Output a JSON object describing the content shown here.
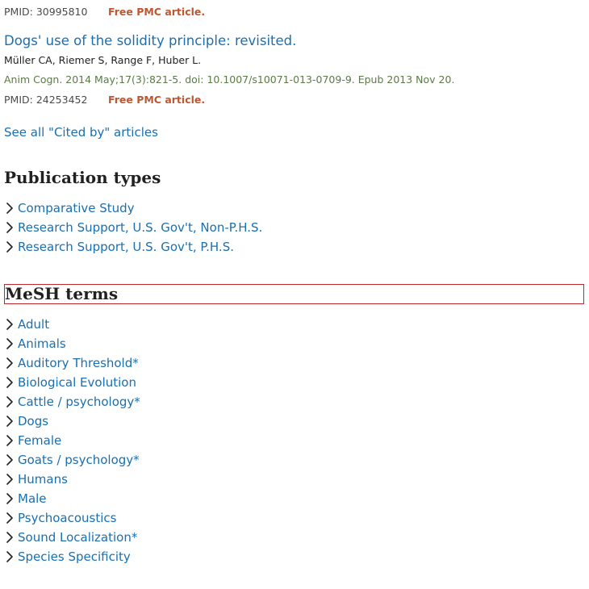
{
  "prev_article": {
    "pmid": "PMID: 30995810",
    "free_label": "Free PMC article."
  },
  "article": {
    "title": "Dogs' use of the solidity principle: revisited.",
    "authors": "Müller CA, Riemer S, Range F, Huber L.",
    "citation": "Anim Cogn. 2014 May;17(3):821-5. doi: 10.1007/s10071-013-0709-9. Epub 2013 Nov 20.",
    "pmid": "PMID: 24253452",
    "free_label": "Free PMC article."
  },
  "see_all_link": "See all \"Cited by\" articles",
  "publication_types": {
    "heading": "Publication types",
    "items": [
      "Comparative Study",
      "Research Support, U.S. Gov't, Non-P.H.S.",
      "Research Support, U.S. Gov't, P.H.S."
    ]
  },
  "mesh_terms": {
    "heading": "MeSH terms",
    "items": [
      "Adult",
      "Animals",
      "Auditory Threshold*",
      "Biological Evolution",
      "Cattle / psychology*",
      "Dogs",
      "Female",
      "Goats / psychology*",
      "Humans",
      "Male",
      "Psychoacoustics",
      "Sound Localization*",
      "Species Specificity"
    ]
  },
  "colors": {
    "link": "#1a6faf",
    "free_pmc": "#c0562f",
    "citation": "#5b7b45",
    "focus_outline": "#c0282d"
  },
  "icons": {
    "term_chevron": "chevron-right-icon"
  }
}
